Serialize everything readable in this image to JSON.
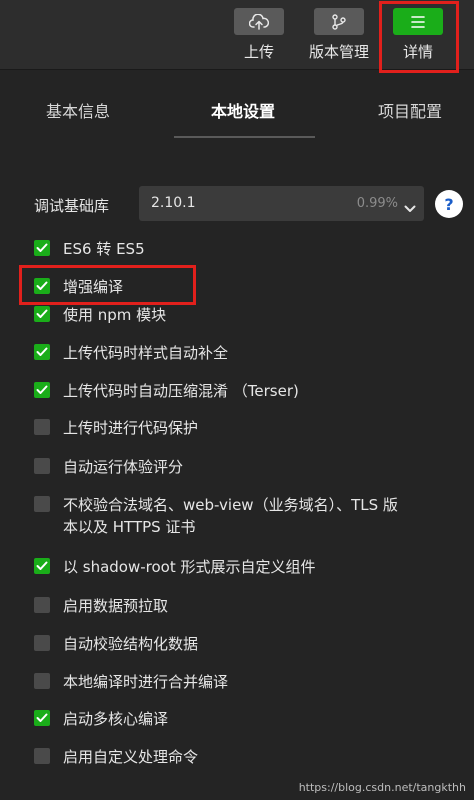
{
  "toolbar": {
    "upload_label": "上传",
    "version_label": "版本管理",
    "detail_label": "详情"
  },
  "tabs": [
    {
      "label": "基本信息"
    },
    {
      "label": "本地设置"
    },
    {
      "label": "项目配置"
    }
  ],
  "lib": {
    "label": "调试基础库",
    "version": "2.10.1",
    "percent": "0.99%",
    "help": "?"
  },
  "options": [
    {
      "label": "ES6 转 ES5",
      "checked": true
    },
    {
      "label": "增强编译",
      "checked": true
    },
    {
      "label": "使用 npm 模块",
      "checked": true
    },
    {
      "label": "上传代码时样式自动补全",
      "checked": true
    },
    {
      "label": "上传代码时自动压缩混淆 （Terser)",
      "checked": true
    },
    {
      "label": "上传时进行代码保护",
      "checked": false
    },
    {
      "label": "自动运行体验评分",
      "checked": false
    },
    {
      "label_line1": "不校验合法域名、web-view（业务域名）、TLS 版",
      "label_line2": "本以及 HTTPS 证书",
      "checked": false
    },
    {
      "label": "以 shadow-root 形式展示自定义组件",
      "checked": true
    },
    {
      "label": "启用数据预拉取",
      "checked": false
    },
    {
      "label": "自动校验结构化数据",
      "checked": false
    },
    {
      "label": "本地编译时进行合并编译",
      "checked": false
    },
    {
      "label": "启动多核心编译",
      "checked": true
    },
    {
      "label": "启用自定义处理命令",
      "checked": false
    }
  ],
  "watermark": "https://blog.csdn.net/tangkthh",
  "colors": {
    "accent": "#1aad19",
    "highlight": "#e1201c",
    "background": "#242424"
  }
}
